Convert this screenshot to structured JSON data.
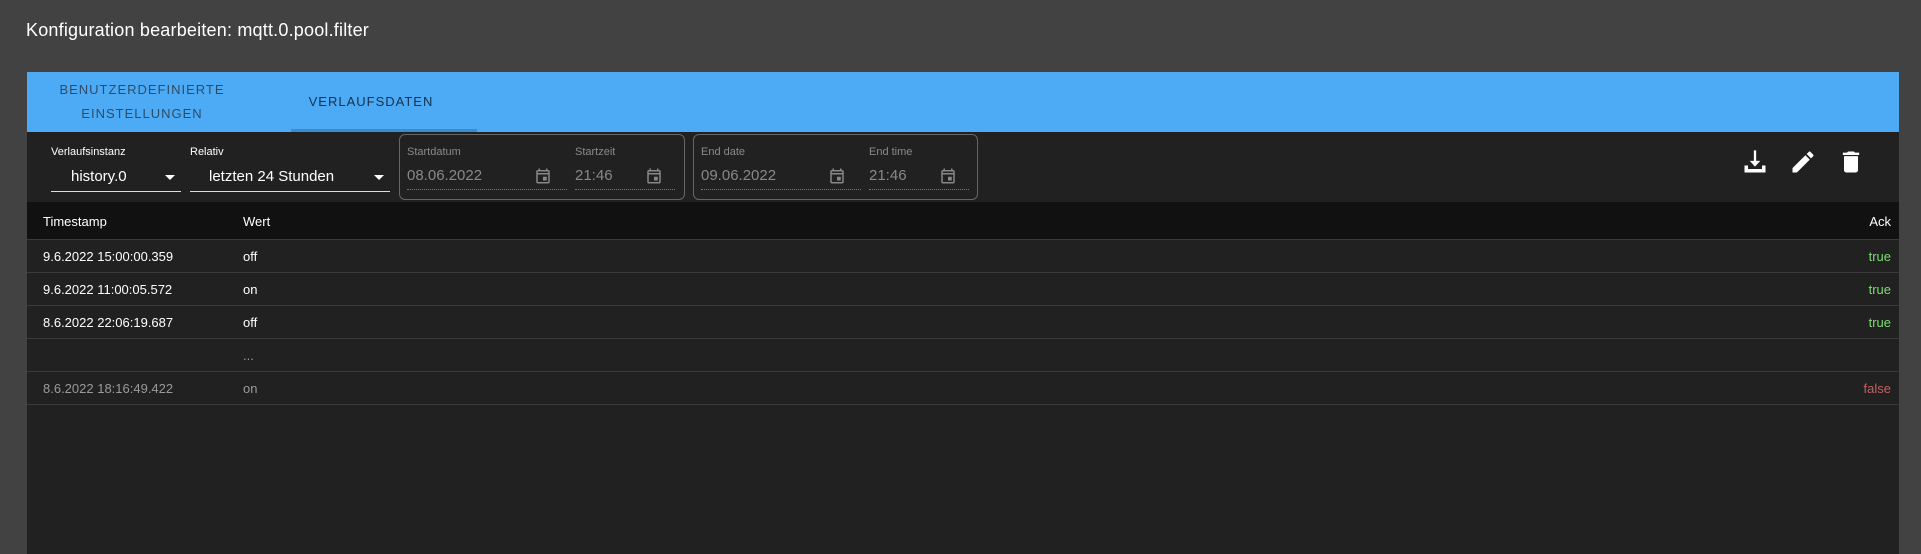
{
  "dialog": {
    "title": "Konfiguration bearbeiten: mqtt.0.pool.filter"
  },
  "tabs": [
    {
      "label_line1": "BENUTZERDEFINIERTE",
      "label_line2": "EINSTELLUNGEN"
    },
    {
      "label": "VERLAUFSDATEN",
      "active": true
    }
  ],
  "toolbar": {
    "instance_label": "Verlaufsinstanz",
    "instance_value": "history.0",
    "relative_label": "Relativ",
    "relative_value": "letzten 24 Stunden",
    "start_date_label": "Startdatum",
    "start_date_value": "08.06.2022",
    "start_time_label": "Startzeit",
    "start_time_value": "21:46",
    "end_date_label": "End date",
    "end_date_value": "09.06.2022",
    "end_time_label": "End time",
    "end_time_value": "21:46",
    "icons": [
      "download-icon",
      "edit-icon",
      "delete-icon"
    ]
  },
  "table": {
    "columns": [
      "Timestamp",
      "Wert",
      "Ack"
    ],
    "rows": [
      {
        "timestamp": "9.6.2022 15:00:00.359",
        "value": "off",
        "ack": "true"
      },
      {
        "timestamp": "9.6.2022 11:00:05.572",
        "value": "on",
        "ack": "true"
      },
      {
        "timestamp": "8.6.2022 22:06:19.687",
        "value": "off",
        "ack": "true"
      },
      {
        "timestamp": "",
        "value": "...",
        "ack": ""
      },
      {
        "timestamp": "8.6.2022 18:16:49.422",
        "value": "on",
        "ack": "false"
      }
    ]
  },
  "colors": {
    "tab_bar": "#4dabf5",
    "ack_true": "#7ddb74",
    "ack_false": "#c06060"
  }
}
